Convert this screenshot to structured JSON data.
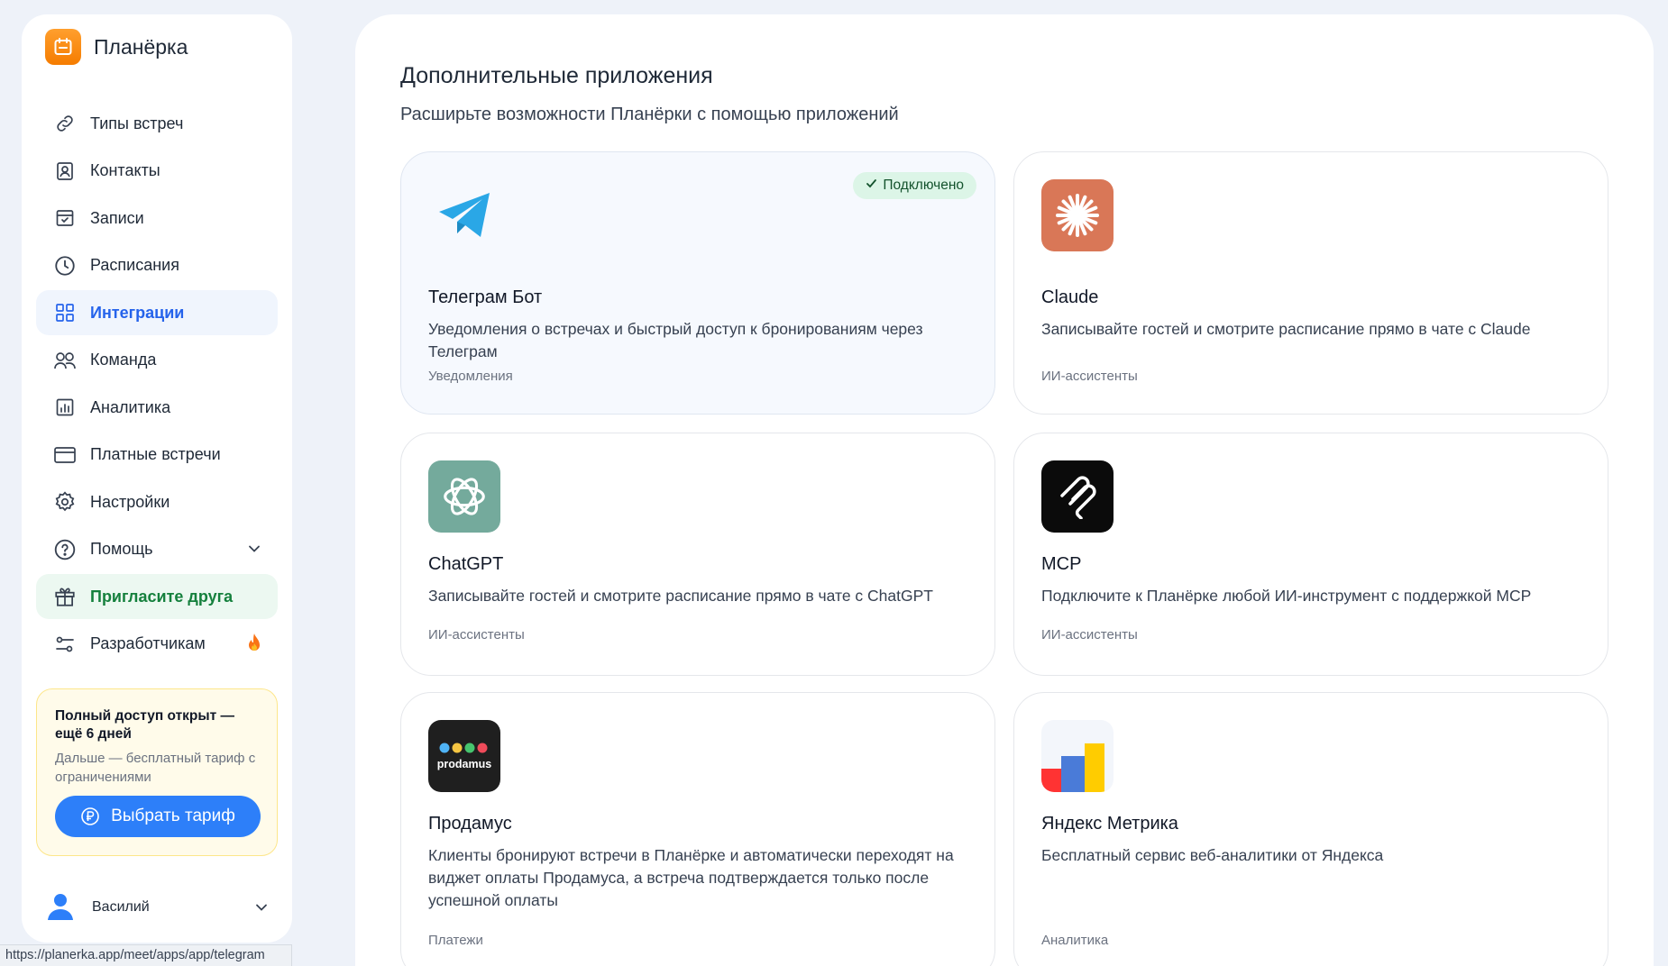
{
  "brand": {
    "name": "Планёрка"
  },
  "sidebar": {
    "items": [
      {
        "label": "Типы встреч",
        "icon": "link-icon"
      },
      {
        "label": "Контакты",
        "icon": "contact-icon"
      },
      {
        "label": "Записи",
        "icon": "calendar-check-icon"
      },
      {
        "label": "Расписания",
        "icon": "clock-icon"
      },
      {
        "label": "Интеграции",
        "icon": "grid-icon",
        "active": true
      },
      {
        "label": "Команда",
        "icon": "team-icon"
      },
      {
        "label": "Аналитика",
        "icon": "chart-icon"
      },
      {
        "label": "Платные встречи",
        "icon": "card-icon"
      },
      {
        "label": "Настройки",
        "icon": "gear-icon"
      },
      {
        "label": "Помощь",
        "icon": "help-icon"
      },
      {
        "label": "Пригласите друга",
        "icon": "gift-icon"
      },
      {
        "label": "Разработчикам",
        "icon": "sliders-icon"
      }
    ]
  },
  "promo": {
    "title": "Полный доступ открыт — ещё 6 дней",
    "subtitle": "Дальше — бесплатный тариф с ограничениями",
    "button_label": "Выбрать тариф"
  },
  "user": {
    "name": "Василий"
  },
  "statusbar": {
    "url": "https://planerka.app/meet/apps/app/telegram"
  },
  "main": {
    "title": "Дополнительные приложения",
    "subtitle": "Расширьте возможности Планёрки с помощью приложений",
    "cards": [
      {
        "name": "Телеграм Бот",
        "desc": "Уведомления о встречах и быстрый доступ к бронированиям через Телеграм",
        "category": "Уведомления",
        "badge": "Подключено",
        "icon": "telegram-icon"
      },
      {
        "name": "Claude",
        "desc": "Записывайте гостей и смотрите расписание прямо в чате с Claude",
        "category": "ИИ-ассистенты",
        "icon": "claude-icon"
      },
      {
        "name": "ChatGPT",
        "desc": "Записывайте гостей и смотрите расписание прямо в чате с ChatGPT",
        "category": "ИИ-ассистенты",
        "icon": "chatgpt-icon"
      },
      {
        "name": "MCP",
        "desc": "Подключите к Планёрке любой ИИ-инструмент с поддержкой MCP",
        "category": "ИИ-ассистенты",
        "icon": "mcp-icon"
      },
      {
        "name": "Продамус",
        "desc": "Клиенты бронируют встречи в Планёрке и автоматически переходят на виджет оплаты Продамуса, а встреча подтверждается только после успешной оплаты",
        "category": "Платежи",
        "icon": "prodamus-icon",
        "logo_text": "prodamus"
      },
      {
        "name": "Яндекс Метрика",
        "desc": "Бесплатный сервис веб-аналитики от Яндекса",
        "category": "Аналитика",
        "icon": "yandex-metrika-icon"
      }
    ]
  },
  "colors": {
    "accent": "#2d7ff9",
    "active_nav": "#2563eb",
    "invite": "#15803d",
    "badge_bg": "#dcf5e7",
    "brand": "#f57c00"
  }
}
